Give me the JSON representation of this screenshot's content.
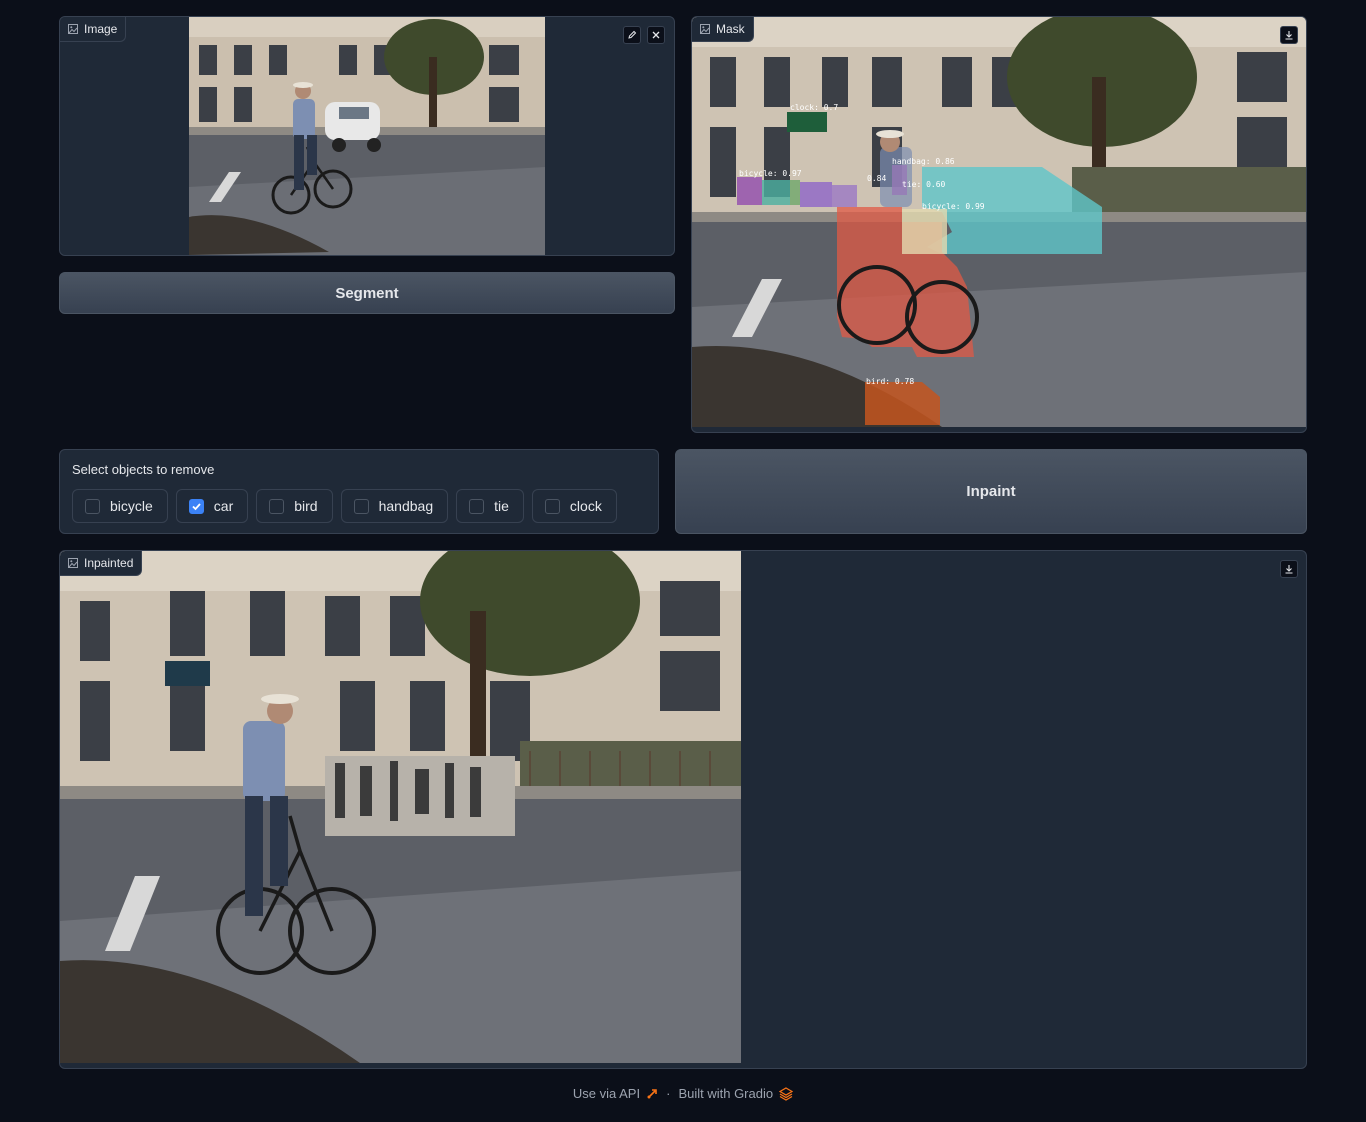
{
  "image_panel": {
    "label": "Image",
    "icon": "image-icon",
    "edit_icon": "pencil-icon",
    "clear_icon": "close-icon"
  },
  "segment_button": {
    "label": "Segment"
  },
  "mask_panel": {
    "label": "Mask",
    "download_icon": "download-icon",
    "detections": [
      {
        "label": "clock: 0.7"
      },
      {
        "label": "handbag: 0.86"
      },
      {
        "label": "bicycle: 0.97"
      },
      {
        "label": "0.84"
      },
      {
        "label": "tie: 0.60"
      },
      {
        "label": "bicycle: 0.99"
      },
      {
        "label": "bird: 0.78"
      }
    ]
  },
  "select_objects": {
    "title": "Select objects to remove",
    "options": [
      {
        "label": "bicycle",
        "checked": false
      },
      {
        "label": "car",
        "checked": true
      },
      {
        "label": "bird",
        "checked": false
      },
      {
        "label": "handbag",
        "checked": false
      },
      {
        "label": "tie",
        "checked": false
      },
      {
        "label": "clock",
        "checked": false
      }
    ]
  },
  "inpaint_button": {
    "label": "Inpaint"
  },
  "inpainted_panel": {
    "label": "Inpainted",
    "download_icon": "download-icon"
  },
  "footer": {
    "api_text": "Use via API",
    "separator": "·",
    "built_text": "Built with Gradio"
  },
  "colors": {
    "background": "#0b0f19",
    "panel": "#1f2937",
    "border": "#374151",
    "accent": "#3b82f6",
    "gradio_orange": "#f97316"
  }
}
